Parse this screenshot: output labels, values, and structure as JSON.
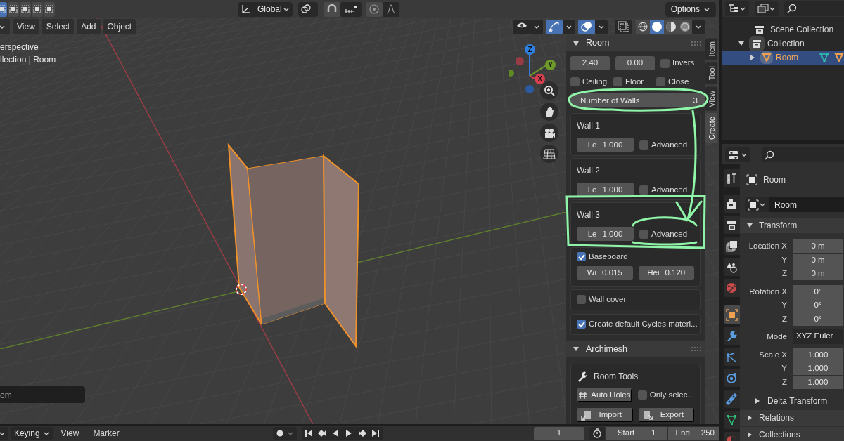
{
  "tool_header": {
    "selection_modes": [
      {
        "selected": true
      },
      {
        "selected": false
      },
      {
        "selected": false
      },
      {
        "selected": false
      },
      {
        "selected": false
      }
    ],
    "transform_orientation": "Global",
    "options": "Options"
  },
  "viewport_menu": [
    "View",
    "Select",
    "Add",
    "Object"
  ],
  "viewport_toggles": [
    {
      "kind": "visibility",
      "on": false
    },
    {
      "kind": "gizmo",
      "on": true
    },
    {
      "kind": "overlay",
      "on": true
    },
    {
      "kind": "xray",
      "on": false
    }
  ],
  "shading_modes": [
    {
      "selected": false
    },
    {
      "selected": true
    },
    {
      "selected": false
    },
    {
      "selected": false
    }
  ],
  "viewport_info": [
    "erspective",
    "llection | Room"
  ],
  "gizmo_axes": [
    "Z",
    "Y",
    "X"
  ],
  "operator_panel": "om",
  "sidebar_tabs": [
    {
      "label": "Item",
      "selected": false
    },
    {
      "label": "Tool",
      "selected": false
    },
    {
      "label": "View",
      "selected": false
    },
    {
      "label": "Create",
      "selected": true
    }
  ],
  "room_panel": {
    "title": "Room",
    "expanded": true,
    "fields": [
      "2.40",
      "0.00"
    ],
    "inverse": {
      "label": "Invers",
      "checked": false
    },
    "options": [
      {
        "label": "Ceiling",
        "checked": false
      },
      {
        "label": "Floor",
        "checked": false
      },
      {
        "label": "Close",
        "checked": false
      }
    ],
    "walls_count": {
      "label": "Number of Walls",
      "value": "3"
    },
    "walls": [
      {
        "title": "Wall 1",
        "length_label": "Le",
        "length": "1.000",
        "advanced": {
          "label": "Advanced",
          "checked": false
        }
      },
      {
        "title": "Wall 2",
        "length_label": "Le",
        "length": "1.000",
        "advanced": {
          "label": "Advanced",
          "checked": false
        }
      },
      {
        "title": "Wall 3",
        "length_label": "Le",
        "length": "1.000",
        "advanced": {
          "label": "Advanced",
          "checked": false
        }
      }
    ],
    "baseboard": {
      "label": "Baseboard",
      "checked": true
    },
    "baseboard_fields": [
      {
        "label": "Wi",
        "value": "0.015"
      },
      {
        "label": "Hei",
        "value": "0.120"
      }
    ],
    "wall_cover": {
      "label": "Wall cover",
      "checked": false
    },
    "cycles_materials": {
      "label": "Create default Cycles materi...",
      "checked": true
    }
  },
  "archimesh_panel": {
    "title": "Archimesh",
    "expanded": true,
    "section": "Room Tools",
    "auto_holes": "Auto Holes",
    "only_selected": {
      "label": "Only selec...",
      "checked": false
    },
    "buttons": [
      "Import",
      "Export"
    ]
  },
  "timeline": {
    "menus": [
      "Keying",
      "View",
      "Marker"
    ],
    "current_frame": "1",
    "start_label": "Start",
    "start": "1",
    "end_label": "End",
    "end": "250"
  },
  "outliner": {
    "items": [
      {
        "label": "Scene Collection",
        "selected": false,
        "children": [
          {
            "label": "Collection",
            "expanded": true,
            "selected": false,
            "children": [
              {
                "label": "Room",
                "expanded": false,
                "selected": true
              }
            ]
          }
        ]
      }
    ]
  },
  "properties": {
    "tabs": [
      {
        "kind": "tool",
        "selected": false
      },
      {
        "kind": "render",
        "selected": false
      },
      {
        "kind": "output",
        "selected": false
      },
      {
        "kind": "view_layer",
        "selected": false
      },
      {
        "kind": "scene",
        "selected": false
      },
      {
        "kind": "world",
        "selected": false
      },
      {
        "kind": "object",
        "selected": true
      },
      {
        "kind": "modifier",
        "selected": false
      },
      {
        "kind": "particles",
        "selected": false
      },
      {
        "kind": "physics",
        "selected": false
      },
      {
        "kind": "constraints",
        "selected": false
      },
      {
        "kind": "data",
        "selected": false
      },
      {
        "kind": "material",
        "selected": false
      }
    ],
    "object_name": "Room",
    "name_field": "Room",
    "transform": {
      "title": "Transform",
      "expanded": true,
      "groups": [
        {
          "kind": "vector",
          "rows": [
            {
              "label": "Location X",
              "value": "0 m"
            },
            {
              "label": "Y",
              "value": "0 m"
            },
            {
              "label": "Z",
              "value": "0 m"
            }
          ]
        },
        {
          "kind": "vector",
          "rows": [
            {
              "label": "Rotation X",
              "value": "0°"
            },
            {
              "label": "Y",
              "value": "0°"
            },
            {
              "label": "Z",
              "value": "0°"
            }
          ]
        },
        {
          "kind": "dropdown",
          "rows": [
            {
              "label": "Mode",
              "value": "XYZ Euler"
            }
          ]
        },
        {
          "kind": "vector",
          "rows": [
            {
              "label": "Scale X",
              "value": "1.000"
            },
            {
              "label": "Y",
              "value": "1.000"
            },
            {
              "label": "Z",
              "value": "1.000"
            }
          ]
        }
      ],
      "subpanels": [
        {
          "title": "Delta Transform",
          "expanded": false
        }
      ]
    },
    "panels": [
      {
        "title": "Relations",
        "expanded": false
      },
      {
        "title": "Collections",
        "expanded": false
      }
    ]
  }
}
